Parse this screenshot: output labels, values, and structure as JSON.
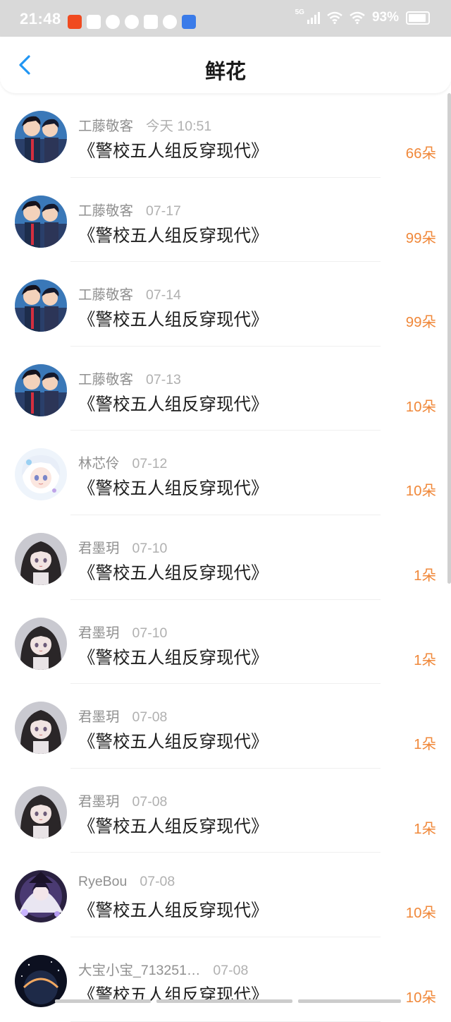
{
  "status_bar": {
    "time": "21:48",
    "network": "5G",
    "battery": "93%"
  },
  "nav": {
    "title": "鲜花",
    "back_icon": "chevron-left-icon",
    "accent": "#2196f3"
  },
  "items": [
    {
      "user": "工藤敬客",
      "date": "今天 10:51",
      "book": "《警校五人组反穿现代》",
      "count": "66朵",
      "avatar": "anime-detectives"
    },
    {
      "user": "工藤敬客",
      "date": "07-17",
      "book": "《警校五人组反穿现代》",
      "count": "99朵",
      "avatar": "anime-detectives"
    },
    {
      "user": "工藤敬客",
      "date": "07-14",
      "book": "《警校五人组反穿现代》",
      "count": "99朵",
      "avatar": "anime-detectives"
    },
    {
      "user": "工藤敬客",
      "date": "07-13",
      "book": "《警校五人组反穿现代》",
      "count": "10朵",
      "avatar": "anime-detectives"
    },
    {
      "user": "林芯伶",
      "date": "07-12",
      "book": "《警校五人组反穿现代》",
      "count": "10朵",
      "avatar": "anime-white-hair"
    },
    {
      "user": "君墨玥",
      "date": "07-10",
      "book": "《警校五人组反穿现代》",
      "count": "1朵",
      "avatar": "anime-dark-hair"
    },
    {
      "user": "君墨玥",
      "date": "07-10",
      "book": "《警校五人组反穿现代》",
      "count": "1朵",
      "avatar": "anime-dark-hair"
    },
    {
      "user": "君墨玥",
      "date": "07-08",
      "book": "《警校五人组反穿现代》",
      "count": "1朵",
      "avatar": "anime-dark-hair"
    },
    {
      "user": "君墨玥",
      "date": "07-08",
      "book": "《警校五人组反穿现代》",
      "count": "1朵",
      "avatar": "anime-dark-hair"
    },
    {
      "user": "RyeBou",
      "date": "07-08",
      "book": "《警校五人组反穿现代》",
      "count": "10朵",
      "avatar": "anime-purple-witch"
    },
    {
      "user": "大宝小宝_713251…",
      "date": "07-08",
      "book": "《警校五人组反穿现代》",
      "count": "10朵",
      "avatar": "dark-planet"
    }
  ]
}
